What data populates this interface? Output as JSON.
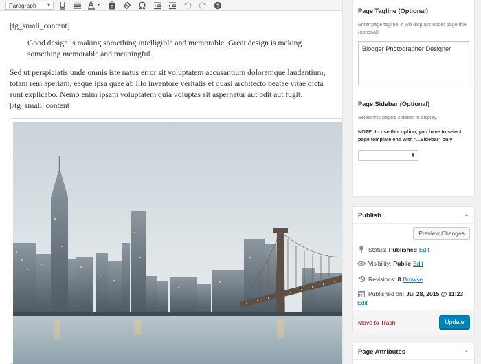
{
  "toolbar": {
    "format_select": "Paragraph"
  },
  "content": {
    "shortcode_open": "[tg_small_content]",
    "blockquote": "Good design is making something intelligible and memorable. Great design is making something memorable and meaningful.",
    "paragraph": "Sed ut perspiciatis unde omnis iste natus error sit voluptatem accusantium doloremque laudantium, totam rem aperiam, eaque ipsa quae ab illo inventore veritatis et quasi architecto beatae vitae dicta sunt explicabo. Nemo enim ipsam voluptatem quia voluptas sit aspernatur aut odit aut fugit.",
    "shortcode_close": "[/tg_small_content]"
  },
  "page_meta": {
    "tagline_title": "Page Tagline (Optional)",
    "tagline_desc": "Enter page tagline. It will displays under page title (optional)",
    "tagline_value": "Blogger Photographer Designer",
    "sidebar_title": "Page Sidebar (Optional)",
    "sidebar_desc": "Select this page's sidebar to display.",
    "sidebar_note": "NOTE: to use this option, you have to select page template end with \"...Sidebar\" only",
    "sidebar_select_value": ""
  },
  "publish": {
    "title": "Publish",
    "preview_label": "Preview Changes",
    "status_label": "Status:",
    "status_value": "Published",
    "visibility_label": "Visibility:",
    "visibility_value": "Public",
    "revisions_label": "Revisions:",
    "revisions_value": "8",
    "browse_label": "Browse",
    "published_label": "Published on:",
    "published_value": "Jul 28, 2015 @ 11:23",
    "edit_label": "Edit",
    "trash_label": "Move to Trash",
    "update_label": "Update"
  },
  "attributes": {
    "title": "Page Attributes"
  },
  "colors": {
    "accent": "#0085ba",
    "link": "#0073aa",
    "trash": "#aa0000"
  }
}
